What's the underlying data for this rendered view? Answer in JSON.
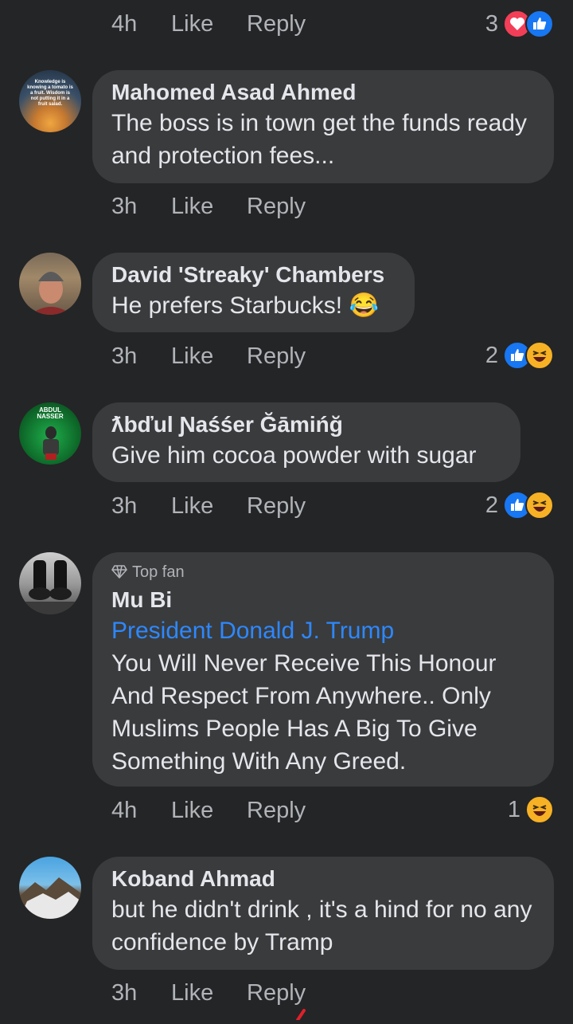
{
  "colors": {
    "background": "#242526",
    "bubble": "#3a3b3c",
    "meta": "#b0b3b8",
    "mention": "#2d88ff",
    "like_blue": "#1877f2",
    "love_red": "#f33e58",
    "haha_yellow": "#f7b125"
  },
  "top_meta": {
    "time": "4h",
    "like": "Like",
    "reply": "Reply",
    "reaction_count": "3",
    "reactions": [
      "love-icon",
      "like-icon"
    ]
  },
  "comments": [
    {
      "author": "Mahomed Asad Ahmed",
      "avatar_text": "Knowledge is knowing a tomato is a fruit. Wisdom is not putting it in a fruit salad.",
      "text": "The boss is in town get the funds ready and protection fees...",
      "time": "3h",
      "like": "Like",
      "reply": "Reply"
    },
    {
      "author": "David 'Streaky' Chambers",
      "text": "He prefers Starbucks! 😂",
      "time": "3h",
      "like": "Like",
      "reply": "Reply",
      "reaction_count": "2",
      "reactions": [
        "like-icon",
        "haha-icon"
      ]
    },
    {
      "author": "ƛbďul Ɲaśśer Ğāmińğ",
      "avatar_text": "ABDUL NASSER",
      "text": "Give him cocoa powder with sugar",
      "time": "3h",
      "like": "Like",
      "reply": "Reply",
      "reaction_count": "2",
      "reactions": [
        "like-icon",
        "haha-icon"
      ]
    },
    {
      "badge": "Top fan",
      "author": "Mu Bi",
      "mention": "President Donald J. Trump",
      "text": "You Will Never Receive This Honour And Respect From Anywhere.. Only Muslims People Has A Big To Give Something With Any Greed.",
      "time": "4h",
      "like": "Like",
      "reply": "Reply",
      "reaction_count": "1",
      "reactions": [
        "haha-icon"
      ]
    },
    {
      "author": "Koband Ahmad",
      "text": "but he didn't drink , it's a hind for no any confidence by Tramp",
      "time": "3h",
      "like": "Like",
      "reply": "Reply"
    }
  ]
}
